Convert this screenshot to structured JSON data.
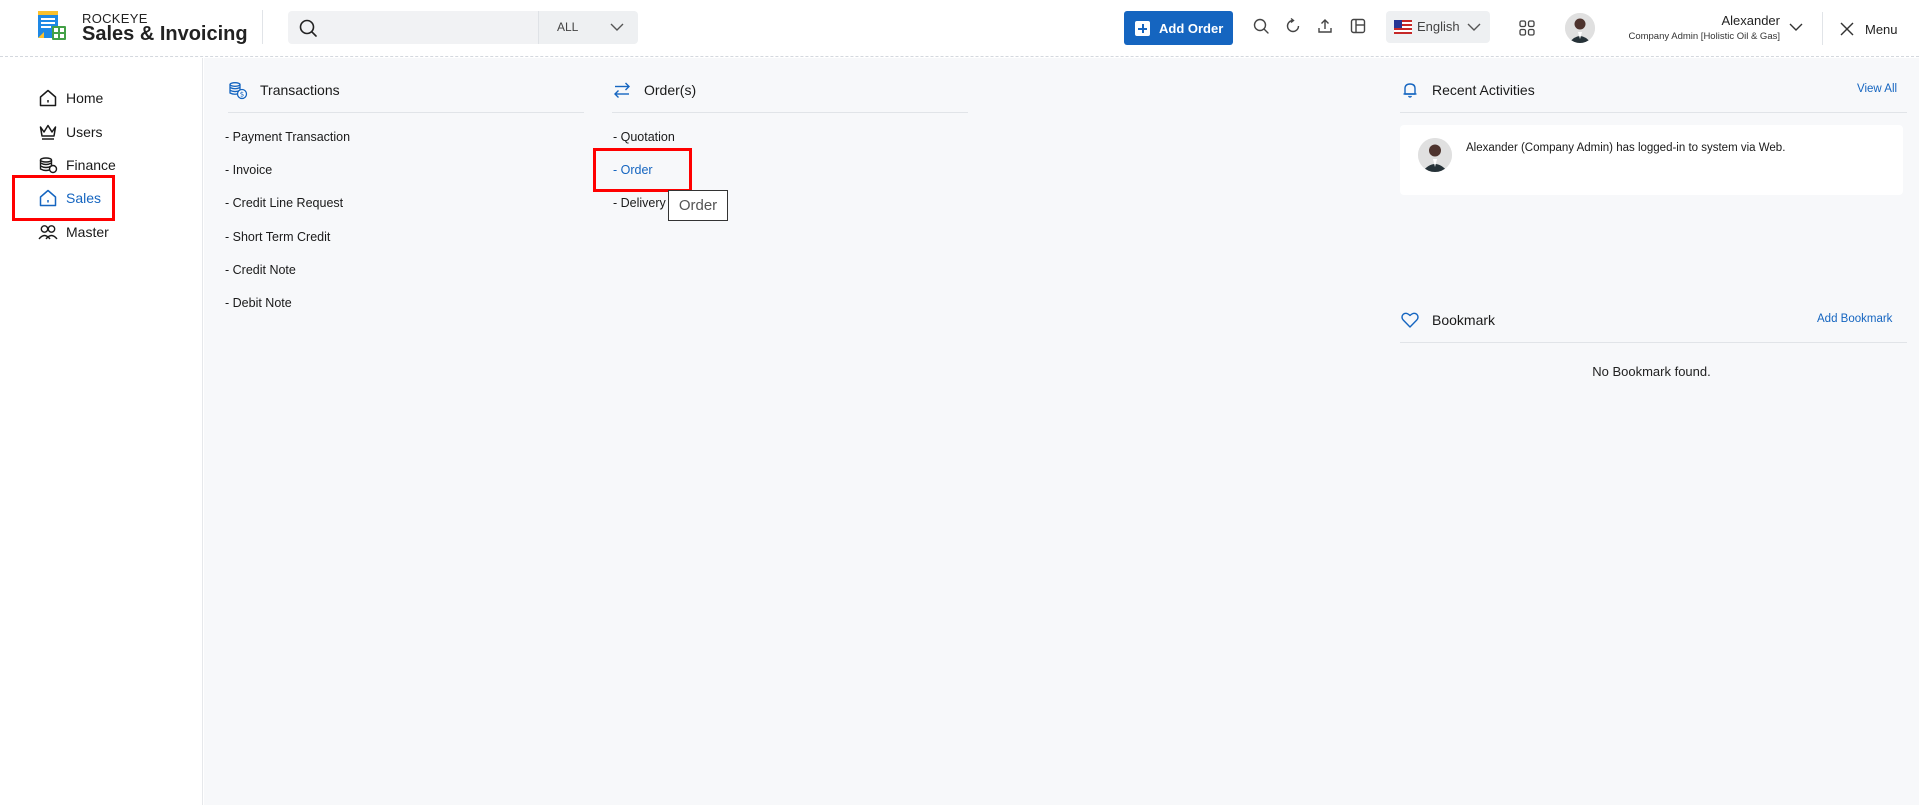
{
  "brand": {
    "company": "ROCKEYE",
    "product": "Sales & Invoicing"
  },
  "header": {
    "search": {
      "value": "",
      "placeholder": ""
    },
    "scope": {
      "selected": "ALL"
    },
    "add_order_label": "Add Order",
    "language": {
      "selected": "English"
    },
    "user": {
      "name": "Alexander",
      "role": "Company Admin [Holistic Oil & Gas]"
    },
    "menu_label": "Menu"
  },
  "sidebar": {
    "items": [
      {
        "label": "Home",
        "icon": "home-icon"
      },
      {
        "label": "Users",
        "icon": "crown-icon"
      },
      {
        "label": "Finance",
        "icon": "coins-icon"
      },
      {
        "label": "Sales",
        "icon": "sales-house-icon",
        "active": true
      },
      {
        "label": "Master",
        "icon": "users-icon"
      }
    ]
  },
  "transactions": {
    "title": "Transactions",
    "items": [
      "- Payment Transaction",
      "- Invoice",
      "- Credit Line Request",
      "- Short Term Credit",
      "- Credit Note",
      "- Debit Note"
    ]
  },
  "orders": {
    "title": "Order(s)",
    "items": [
      "- Quotation",
      "- Order",
      "- Delivery"
    ],
    "tooltip": "Order"
  },
  "recent_activities": {
    "title": "Recent Activities",
    "view_all": "View All",
    "entries": [
      {
        "text": "Alexander (Company Admin) has logged-in to system via Web."
      }
    ]
  },
  "bookmark": {
    "title": "Bookmark",
    "add_label": "Add Bookmark",
    "empty_message": "No Bookmark found."
  },
  "colors": {
    "accent": "#1565c0",
    "highlight": "#ff0000",
    "main_bg": "#f7f8fa"
  }
}
